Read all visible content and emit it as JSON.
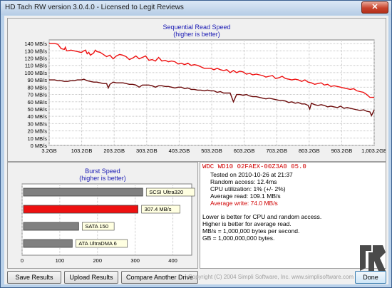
{
  "window": {
    "title": "HD Tach RW version 3.0.4.0 - Licensed to Legit Reviews",
    "close_label": "✕"
  },
  "seq": {
    "title_line1": "Sequential Read Speed",
    "title_line2": "(higher is better)",
    "y_labels": [
      "140 MB/s",
      "130 MB/s",
      "120 MB/s",
      "110 MB/s",
      "100 MB/s",
      "90 MB/s",
      "80 MB/s",
      "70 MB/s",
      "60 MB/s",
      "50 MB/s",
      "40 MB/s",
      "30 MB/s",
      "20 MB/s",
      "10 MB/s",
      "0 MB/s"
    ],
    "x_labels": [
      "3.2GB",
      "103.2GB",
      "203.2GB",
      "303.2GB",
      "403.2GB",
      "503.2GB",
      "603.2GB",
      "703.2GB",
      "803.2GB",
      "903.2GB",
      "1,003.2GB"
    ]
  },
  "burst": {
    "title_line1": "Burst Speed",
    "title_line2": "(higher is better)",
    "x_labels": [
      "0",
      "100",
      "200",
      "300",
      "400"
    ],
    "bars": [
      {
        "label": "SCSI Ultra320",
        "value": 320,
        "color": "#808080"
      },
      {
        "label": "307.4 MB/s",
        "value": 307.4,
        "color": "#ee1111"
      },
      {
        "label": "SATA 150",
        "value": 150,
        "color": "#808080"
      },
      {
        "label": "ATA UltraDMA 6",
        "value": 133,
        "color": "#808080"
      }
    ]
  },
  "info": {
    "drive": "WDC WD10 02FAEX-00Z3A0 05.0",
    "tested": "Tested on 2010-10-26 at 21:37",
    "random": "Random access: 12.4ms",
    "cpu": "CPU utilization: 1% (+/- 2%)",
    "avg_read": "Average read: 109.1 MB/s",
    "avg_write": "Average write: 74.0 MB/s",
    "note1": "Lower is better for CPU and random access.",
    "note2": "Higher is better for average read.",
    "note3": "MB/s = 1,000,000 bytes per second.",
    "note4": "GB = 1,000,000,000 bytes."
  },
  "buttons": {
    "save": "Save Results",
    "upload": "Upload Results",
    "compare": "Compare Another Drive",
    "done": "Done"
  },
  "copyright": "Copyright (C) 2004 Simpli Software, Inc. www.simplisoftware.com",
  "chart_data": [
    {
      "type": "line",
      "title": "Sequential Read Speed",
      "subtitle": "(higher is better)",
      "ylim": [
        0,
        145
      ],
      "grid": true,
      "series": [
        {
          "color": "#ee1111",
          "x": [
            3.2,
            10,
            20,
            30,
            40,
            50,
            53,
            57,
            60,
            70,
            80,
            90,
            100,
            103,
            110,
            115,
            120,
            125,
            130,
            140,
            145,
            150,
            160,
            170,
            180,
            190,
            200,
            210,
            220,
            230,
            240,
            250,
            260,
            270,
            280,
            290,
            300,
            310,
            320,
            330,
            340,
            350,
            360,
            370,
            380,
            390,
            400,
            410,
            420,
            430,
            440,
            450,
            460,
            470,
            480,
            490,
            500,
            510,
            520,
            530,
            540,
            550,
            560,
            570,
            580,
            590,
            600,
            610,
            620,
            630,
            640,
            650,
            660,
            670,
            680,
            690,
            700,
            710,
            720,
            730,
            740,
            750,
            760,
            770,
            780,
            790,
            800,
            810,
            820,
            830,
            840,
            850,
            860,
            870,
            880,
            890,
            900,
            910,
            920,
            930,
            940,
            950,
            960,
            970,
            980,
            990,
            1003.2
          ],
          "values": [
            140,
            140,
            140,
            139,
            133,
            132,
            135,
            130,
            130,
            131,
            130,
            129,
            128,
            128,
            130,
            131,
            126,
            128,
            124,
            127,
            131,
            129,
            128,
            125,
            122,
            124,
            119,
            123,
            125,
            124,
            122,
            118,
            120,
            123,
            119,
            121,
            123,
            117,
            118,
            116,
            121,
            116,
            117,
            115,
            116,
            115,
            112,
            113,
            111,
            113,
            110,
            111,
            110,
            108,
            106,
            106,
            106,
            104,
            106,
            104,
            103,
            104,
            100,
            103,
            100,
            102,
            101,
            98,
            99,
            97,
            98,
            97,
            96,
            94,
            95,
            96,
            92,
            93,
            95,
            92,
            91,
            90,
            91,
            90,
            88,
            90,
            87,
            86,
            84,
            85,
            86,
            83,
            84,
            81,
            82,
            81,
            80,
            79,
            78,
            77,
            78,
            75,
            74,
            73,
            70,
            66,
            66
          ]
        },
        {
          "color": "#6b0a0a",
          "x": [
            3.2,
            10,
            20,
            30,
            40,
            50,
            60,
            70,
            80,
            90,
            100,
            103,
            110,
            120,
            130,
            140,
            150,
            160,
            170,
            180,
            185,
            190,
            200,
            210,
            220,
            230,
            240,
            250,
            260,
            270,
            280,
            290,
            300,
            310,
            320,
            330,
            340,
            350,
            360,
            370,
            380,
            390,
            400,
            410,
            420,
            430,
            440,
            450,
            460,
            470,
            480,
            490,
            500,
            510,
            520,
            530,
            540,
            550,
            560,
            570,
            580,
            590,
            600,
            610,
            620,
            630,
            640,
            650,
            660,
            670,
            680,
            690,
            700,
            710,
            720,
            730,
            740,
            750,
            760,
            770,
            780,
            790,
            800,
            805,
            810,
            820,
            830,
            840,
            850,
            860,
            870,
            880,
            890,
            900,
            910,
            920,
            930,
            940,
            950,
            960,
            970,
            980,
            990,
            995,
            1003.2
          ],
          "values": [
            90,
            90,
            90,
            89,
            89,
            88,
            88,
            89,
            89,
            90,
            90,
            90,
            91,
            89,
            88,
            87,
            87,
            86,
            85,
            85,
            79,
            84,
            87,
            86,
            86,
            86,
            85,
            84,
            84,
            83,
            80,
            83,
            83,
            83,
            82,
            80,
            82,
            82,
            81,
            81,
            80,
            79,
            80,
            80,
            78,
            79,
            77,
            77,
            76,
            76,
            75,
            76,
            75,
            75,
            73,
            74,
            72,
            72,
            72,
            60,
            70,
            70,
            69,
            70,
            68,
            67,
            67,
            66,
            65,
            64,
            65,
            64,
            63,
            62,
            62,
            61,
            59,
            60,
            58,
            59,
            57,
            57,
            55,
            50,
            58,
            56,
            55,
            56,
            55,
            53,
            54,
            53,
            52,
            54,
            51,
            52,
            51,
            50,
            49,
            48,
            49,
            47,
            46,
            41,
            49
          ]
        }
      ]
    },
    {
      "type": "bar",
      "title": "Burst Speed",
      "subtitle": "(higher is better)",
      "categories": [
        "SCSI Ultra320",
        "307.4 MB/s",
        "SATA 150",
        "ATA UltraDMA 6"
      ],
      "values": [
        320,
        307.4,
        150,
        133
      ],
      "xlim": [
        0,
        450
      ],
      "grid": true
    }
  ]
}
